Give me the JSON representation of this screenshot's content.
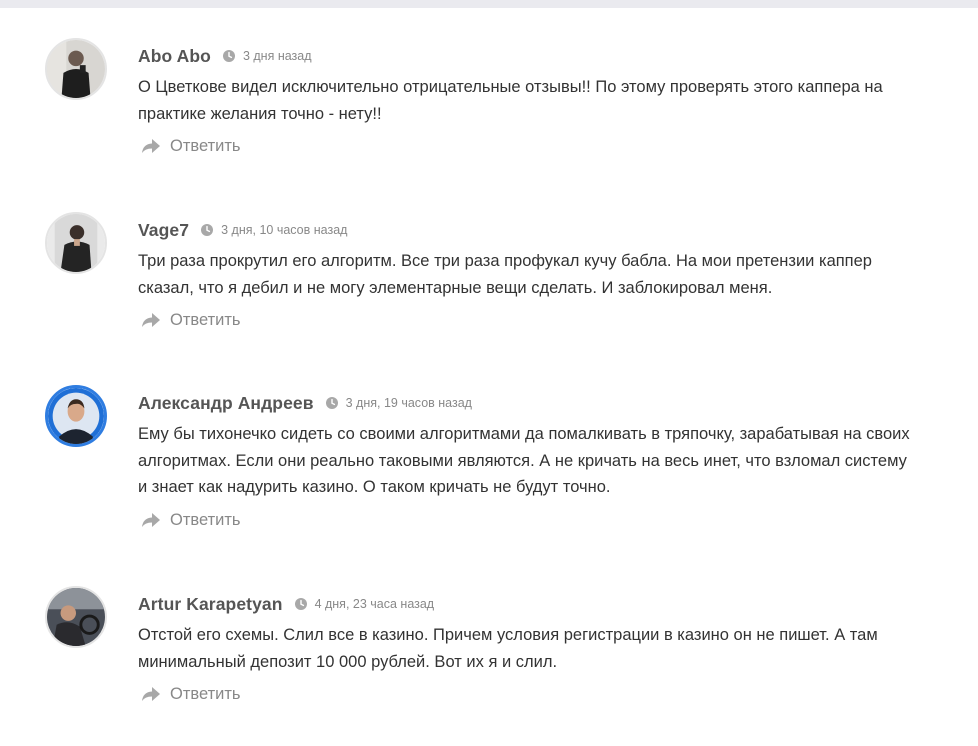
{
  "comments": [
    {
      "author": "Abo Abo",
      "date": "3 дня назад",
      "text": "О Цветкове видел исключительно отрицательные отзывы!! По этому проверять этого каппера на практике желания точно - нету!!",
      "reply_label": "Ответить"
    },
    {
      "author": "Vage7",
      "date": "3 дня, 10 часов назад",
      "text": "Три раза прокрутил его алгоритм. Все три раза профукал кучу бабла. На мои претензии каппер сказал, что я дебил и не могу элементарные вещи сделать. И заблокировал меня.",
      "reply_label": "Ответить"
    },
    {
      "author": "Александр Андреев",
      "date": "3 дня, 19 часов назад",
      "text": "Ему бы тихонечко сидеть со своими алгоритмами да помалкивать в тряпочку, зарабатывая на своих алгоритмах. Если они реально таковыми являются. А не кричать на весь инет, что взломал систему и знает как надурить казино. О таком кричать не будут точно.",
      "reply_label": "Ответить"
    },
    {
      "author": "Artur Karapetyan",
      "date": "4 дня, 23 часа назад",
      "text": "Отстой его схемы. Слил все в казино. Причем условия регистрации в казино он не пишет. А там минимальный депозит 10 000 рублей. Вот их я и слил.",
      "reply_label": "Ответить"
    }
  ],
  "icons": {
    "clock": "clock-icon",
    "reply": "reply-arrow-icon"
  },
  "colors": {
    "author": "#555555",
    "date": "#888888",
    "text": "#333333",
    "reply": "#888888",
    "icon": "#a8a8a8",
    "avatar_ring_accent": "#2f7de1"
  }
}
